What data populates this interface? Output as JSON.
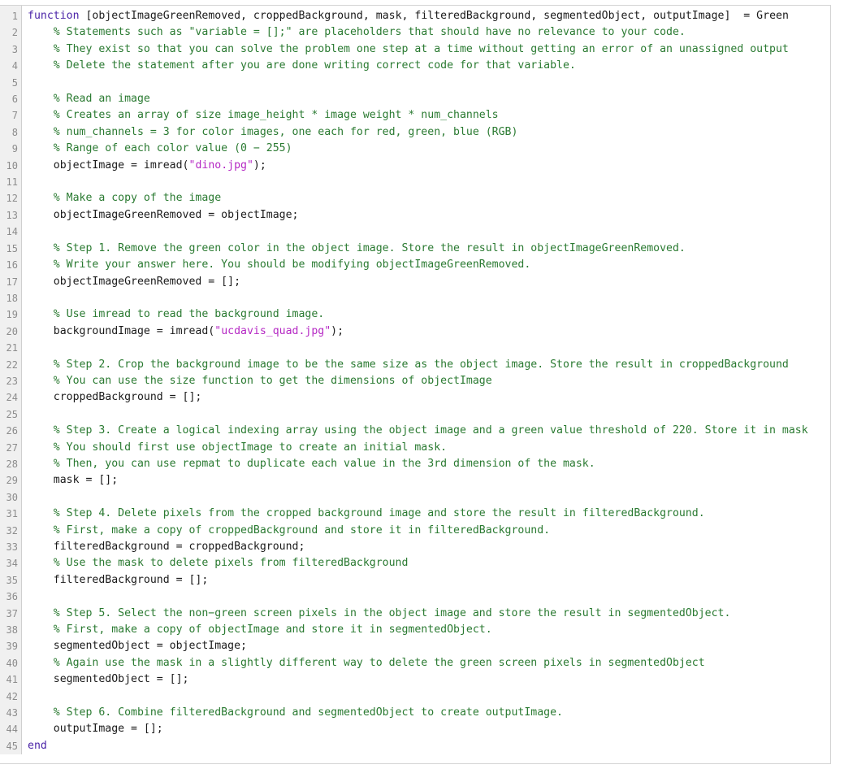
{
  "editor": {
    "language": "matlab",
    "total_lines": 45,
    "first_visible_line": 1,
    "colors": {
      "background": "#ffffff",
      "gutter_background": "#f0f0f0",
      "gutter_text": "#8c8c8c",
      "gutter_divider": "#cfcfcf",
      "keyword": "#4b24a8",
      "comment": "#2a7a31",
      "string": "#b528c4",
      "plain_text": "#1a1a1a",
      "border": "#d4d4d4"
    }
  },
  "lines": [
    {
      "number": "1",
      "tokens": [
        {
          "type": "kw",
          "text": "function"
        },
        {
          "type": "plain",
          "text": " [objectImageGreenRemoved, croppedBackground, mask, filteredBackground, segmentedObject, outputImage]  = Green"
        }
      ]
    },
    {
      "number": "2",
      "tokens": [
        {
          "type": "comment",
          "text": "    % Statements such as \"variable = [];\" are placeholders that should have no relevance to your code."
        }
      ]
    },
    {
      "number": "3",
      "tokens": [
        {
          "type": "comment",
          "text": "    % They exist so that you can solve the problem one step at a time without getting an error of an unassigned output"
        }
      ]
    },
    {
      "number": "4",
      "tokens": [
        {
          "type": "comment",
          "text": "    % Delete the statement after you are done writing correct code for that variable."
        }
      ]
    },
    {
      "number": "5",
      "tokens": []
    },
    {
      "number": "6",
      "tokens": [
        {
          "type": "comment",
          "text": "    % Read an image"
        }
      ]
    },
    {
      "number": "7",
      "tokens": [
        {
          "type": "comment",
          "text": "    % Creates an array of size image_height * image weight * num_channels"
        }
      ]
    },
    {
      "number": "8",
      "tokens": [
        {
          "type": "comment",
          "text": "    % num_channels = 3 for color images, one each for red, green, blue (RGB)"
        }
      ]
    },
    {
      "number": "9",
      "tokens": [
        {
          "type": "comment",
          "text": "    % Range of each color value (0 − 255)"
        }
      ]
    },
    {
      "number": "10",
      "tokens": [
        {
          "type": "plain",
          "text": "    objectImage = imread("
        },
        {
          "type": "string",
          "text": "\"dino.jpg\""
        },
        {
          "type": "plain",
          "text": ");"
        }
      ]
    },
    {
      "number": "11",
      "tokens": []
    },
    {
      "number": "12",
      "tokens": [
        {
          "type": "comment",
          "text": "    % Make a copy of the image"
        }
      ]
    },
    {
      "number": "13",
      "tokens": [
        {
          "type": "plain",
          "text": "    objectImageGreenRemoved = objectImage;"
        }
      ]
    },
    {
      "number": "14",
      "tokens": []
    },
    {
      "number": "15",
      "tokens": [
        {
          "type": "comment",
          "text": "    % Step 1. Remove the green color in the object image. Store the result in objectImageGreenRemoved."
        }
      ]
    },
    {
      "number": "16",
      "tokens": [
        {
          "type": "comment",
          "text": "    % Write your answer here. You should be modifying objectImageGreenRemoved."
        }
      ]
    },
    {
      "number": "17",
      "tokens": [
        {
          "type": "plain",
          "text": "    objectImageGreenRemoved = [];"
        }
      ]
    },
    {
      "number": "18",
      "tokens": []
    },
    {
      "number": "19",
      "tokens": [
        {
          "type": "comment",
          "text": "    % Use imread to read the background image."
        }
      ]
    },
    {
      "number": "20",
      "tokens": [
        {
          "type": "plain",
          "text": "    backgroundImage = imread("
        },
        {
          "type": "string",
          "text": "\"ucdavis_quad.jpg\""
        },
        {
          "type": "plain",
          "text": ");"
        }
      ]
    },
    {
      "number": "21",
      "tokens": []
    },
    {
      "number": "22",
      "tokens": [
        {
          "type": "comment",
          "text": "    % Step 2. Crop the background image to be the same size as the object image. Store the result in croppedBackground"
        }
      ]
    },
    {
      "number": "23",
      "tokens": [
        {
          "type": "comment",
          "text": "    % You can use the size function to get the dimensions of objectImage"
        }
      ]
    },
    {
      "number": "24",
      "tokens": [
        {
          "type": "plain",
          "text": "    croppedBackground = [];"
        }
      ]
    },
    {
      "number": "25",
      "tokens": []
    },
    {
      "number": "26",
      "tokens": [
        {
          "type": "comment",
          "text": "    % Step 3. Create a logical indexing array using the object image and a green value threshold of 220. Store it in mask"
        }
      ]
    },
    {
      "number": "27",
      "tokens": [
        {
          "type": "comment",
          "text": "    % You should first use objectImage to create an initial mask."
        }
      ]
    },
    {
      "number": "28",
      "tokens": [
        {
          "type": "comment",
          "text": "    % Then, you can use repmat to duplicate each value in the 3rd dimension of the mask."
        }
      ]
    },
    {
      "number": "29",
      "tokens": [
        {
          "type": "plain",
          "text": "    mask = [];"
        }
      ]
    },
    {
      "number": "30",
      "tokens": []
    },
    {
      "number": "31",
      "tokens": [
        {
          "type": "comment",
          "text": "    % Step 4. Delete pixels from the cropped background image and store the result in filteredBackground."
        }
      ]
    },
    {
      "number": "32",
      "tokens": [
        {
          "type": "comment",
          "text": "    % First, make a copy of croppedBackground and store it in filteredBackground."
        }
      ]
    },
    {
      "number": "33",
      "tokens": [
        {
          "type": "plain",
          "text": "    filteredBackground = croppedBackground;"
        }
      ]
    },
    {
      "number": "34",
      "tokens": [
        {
          "type": "comment",
          "text": "    % Use the mask to delete pixels from filteredBackground"
        }
      ]
    },
    {
      "number": "35",
      "tokens": [
        {
          "type": "plain",
          "text": "    filteredBackground = [];"
        }
      ]
    },
    {
      "number": "36",
      "tokens": []
    },
    {
      "number": "37",
      "tokens": [
        {
          "type": "comment",
          "text": "    % Step 5. Select the non−green screen pixels in the object image and store the result in segmentedObject."
        }
      ]
    },
    {
      "number": "38",
      "tokens": [
        {
          "type": "comment",
          "text": "    % First, make a copy of objectImage and store it in segmentedObject."
        }
      ]
    },
    {
      "number": "39",
      "tokens": [
        {
          "type": "plain",
          "text": "    segmentedObject = objectImage;"
        }
      ]
    },
    {
      "number": "40",
      "tokens": [
        {
          "type": "comment",
          "text": "    % Again use the mask in a slightly different way to delete the green screen pixels in segmentedObject"
        }
      ]
    },
    {
      "number": "41",
      "tokens": [
        {
          "type": "plain",
          "text": "    segmentedObject = [];"
        }
      ]
    },
    {
      "number": "42",
      "tokens": []
    },
    {
      "number": "43",
      "tokens": [
        {
          "type": "comment",
          "text": "    % Step 6. Combine filteredBackground and segmentedObject to create outputImage."
        }
      ]
    },
    {
      "number": "44",
      "tokens": [
        {
          "type": "plain",
          "text": "    outputImage = [];"
        }
      ]
    },
    {
      "number": "45",
      "tokens": [
        {
          "type": "kw",
          "text": "end"
        }
      ]
    }
  ]
}
